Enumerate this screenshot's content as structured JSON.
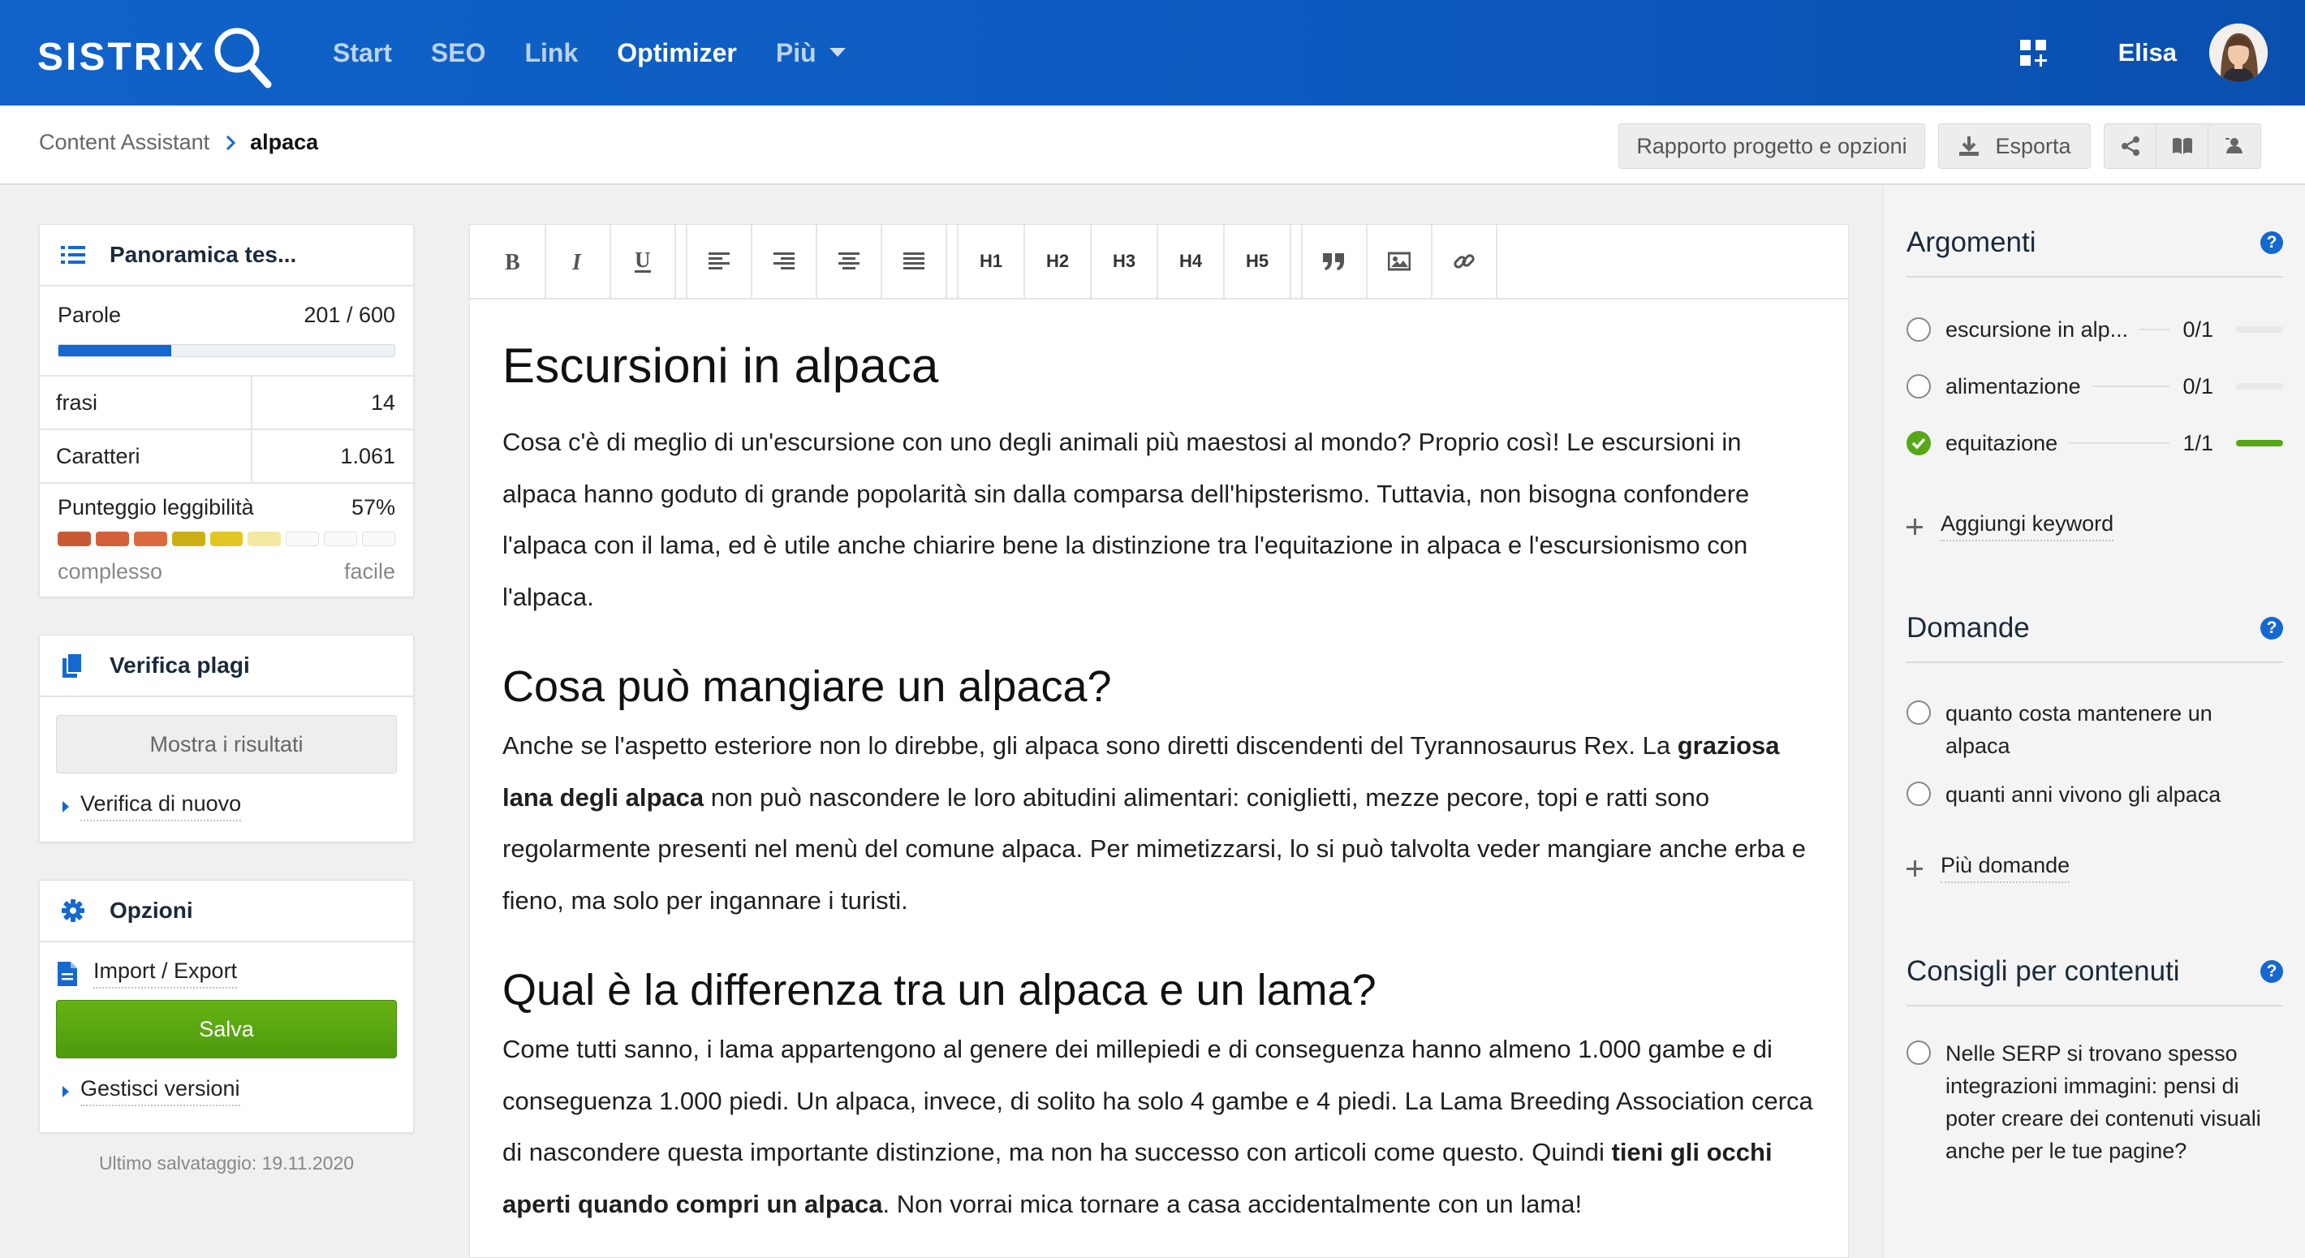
{
  "header": {
    "logo_text": "SISTRIX",
    "nav": {
      "start": "Start",
      "seo": "SEO",
      "link": "Link",
      "optimizer": "Optimizer",
      "more": "Più"
    },
    "user_name": "Elisa"
  },
  "breadcrumb": {
    "parent": "Content Assistant",
    "current": "alpaca"
  },
  "actions": {
    "project_report": "Rapporto progetto e opzioni",
    "export": "Esporta"
  },
  "overview": {
    "title": "Panoramica tes...",
    "words_label": "Parole",
    "words_value": "201 / 600",
    "words_progress": 0.335,
    "sentences_label": "frasi",
    "sentences_value": "14",
    "chars_label": "Caratteri",
    "chars_value": "1.061",
    "readability_label": "Punteggio leggibilità",
    "readability_value": "57%",
    "readability_segments": [
      "#c75a34",
      "#d3603b",
      "#da6b3f",
      "#cdae18",
      "#e3c624",
      "#f4e9a0",
      "#fafafa",
      "#fafafa",
      "#fafafa"
    ],
    "scale_low": "complesso",
    "scale_high": "facile"
  },
  "plagiarism": {
    "title": "Verifica plagi",
    "show_results": "Mostra i risultati",
    "recheck": "Verifica di nuovo"
  },
  "options": {
    "title": "Opzioni",
    "import_export": "Import / Export",
    "save": "Salva",
    "manage_versions": "Gestisci versioni"
  },
  "last_saved": "Ultimo salvataggio: 19.11.2020",
  "toolbar": {
    "h1": "H1",
    "h2": "H2",
    "h3": "H3",
    "h4": "H4",
    "h5": "H5"
  },
  "article": {
    "h1": "Escursioni in alpaca",
    "p1": "Cosa c'è di meglio di un'escursione con uno degli animali più maestosi al mondo? Proprio così! Le escursioni in alpaca hanno goduto di grande popolarità sin dalla comparsa dell'hipsterismo. Tuttavia, non bisogna confondere l'alpaca con il lama, ed è utile anche chiarire bene la distinzione tra l'equitazione in alpaca e l'escursionismo con l'alpaca.",
    "h2a": "Cosa può mangiare un alpaca?",
    "p2_before": "Anche se l'aspetto esteriore non lo direbbe, gli alpaca sono diretti discendenti del Tyrannosaurus Rex. La ",
    "p2_bold": "graziosa lana degli alpaca",
    "p2_after": " non può nascondere le loro abitudini alimentari: coniglietti, mezze pecore, topi e ratti sono regolarmente presenti nel menù del comune alpaca. Per mimetizzarsi, lo si può talvolta veder mangiare anche erba e fieno, ma solo per ingannare i turisti.",
    "h2b": "Qual è la differenza tra un alpaca e un lama?",
    "p3_before": "Come tutti sanno, i lama appartengono al genere dei millepiedi e di conseguenza hanno almeno 1.000 gambe e di conseguenza 1.000 piedi. Un alpaca, invece, di solito ha solo 4 gambe e 4 piedi. La Lama Breeding Association cerca di nascondere questa importante distinzione, ma non ha successo con articoli come questo. Quindi ",
    "p3_bold": "tieni gli occhi aperti quando compri un alpaca",
    "p3_after": ". Non vorrai mica tornare a casa accidentalmente con un lama!"
  },
  "topics": {
    "title": "Argomenti",
    "items": [
      {
        "label": "escursione in alp...",
        "count": "0/1",
        "done": false
      },
      {
        "label": "alimentazione",
        "count": "0/1",
        "done": false
      },
      {
        "label": "equitazione",
        "count": "1/1",
        "done": true
      }
    ],
    "add_keyword": "Aggiungi keyword"
  },
  "questions": {
    "title": "Domande",
    "items": [
      "quanto costa mantenere un alpaca",
      "quanti anni vivono gli alpaca"
    ],
    "more": "Più domande"
  },
  "tips": {
    "title": "Consigli per contenuti",
    "items": [
      "Nelle SERP si trovano spesso integrazioni immagini: pensi di poter creare dei contenuti visuali anche per le tue pagine?"
    ]
  },
  "colors": {
    "brand_blue": "#1062c8",
    "save_green": "#5aa611",
    "progress_blue": "#1468d0",
    "done_green": "#56a817"
  },
  "icons": [
    "search-logo-icon",
    "chevron-down-icon",
    "apps-grid-icon",
    "download-icon",
    "share-icon",
    "book-icon",
    "user-card-icon",
    "list-icon",
    "copy-docs-icon",
    "gear-icon",
    "document-icon",
    "help-icon",
    "check-circle-icon",
    "plus-icon"
  ]
}
